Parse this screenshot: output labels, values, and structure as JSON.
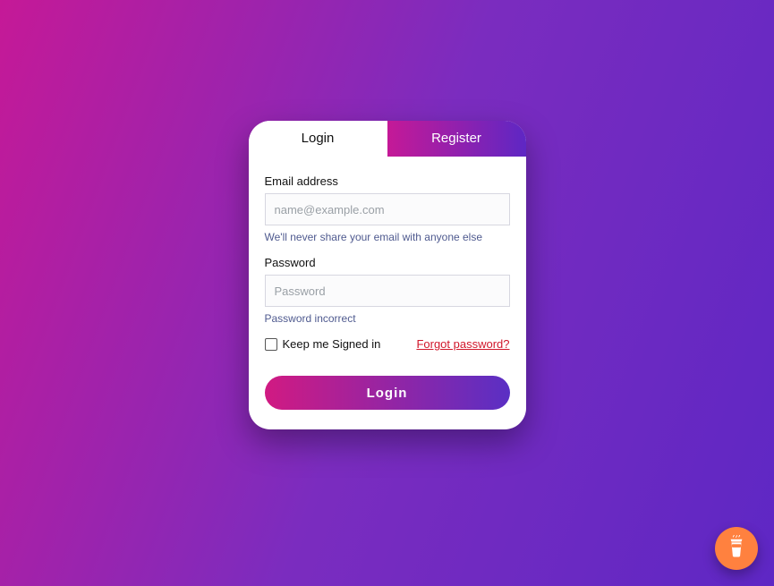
{
  "tabs": {
    "login": "Login",
    "register": "Register"
  },
  "email": {
    "label": "Email address",
    "placeholder": "name@example.com",
    "helper": "We'll never share your email with anyone else"
  },
  "password": {
    "label": "Password",
    "placeholder": "Password",
    "helper": "Password incorrect"
  },
  "keepSigned": "Keep me Signed in",
  "forgot": "Forgot password?",
  "loginBtn": "Login"
}
